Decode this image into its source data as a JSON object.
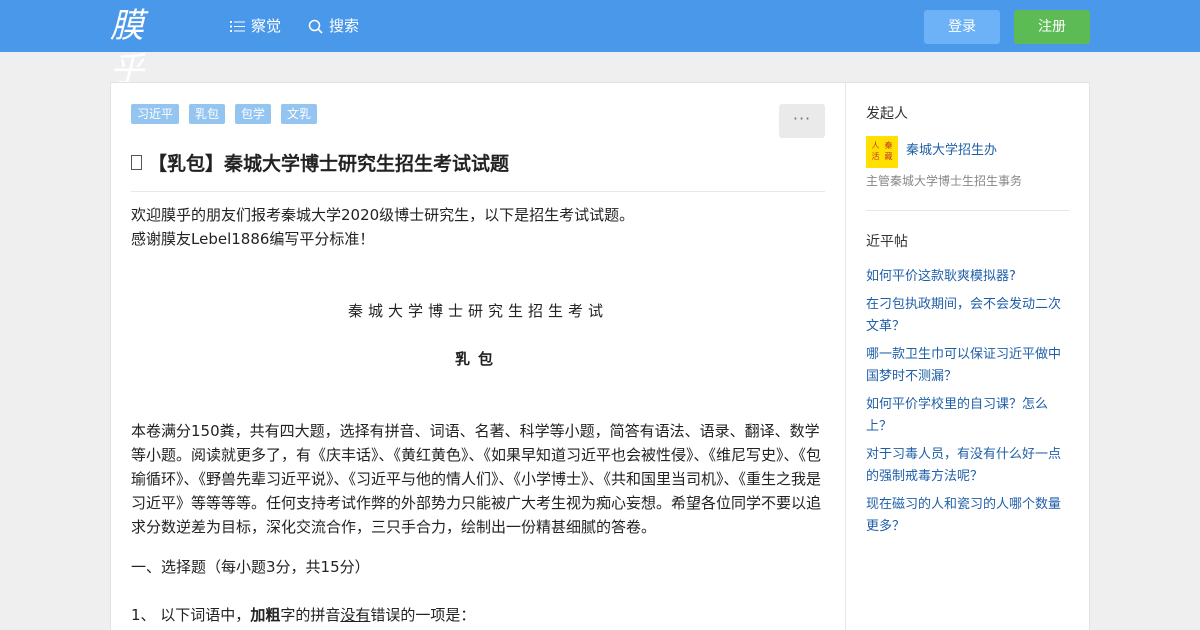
{
  "header": {
    "logo": "膜乎",
    "nav": [
      {
        "label": "察觉",
        "icon": "list-icon"
      },
      {
        "label": "搜索",
        "icon": "search-icon"
      }
    ],
    "login_label": "登录",
    "signup_label": "注册"
  },
  "colors": {
    "header_bg": "#4a98ea",
    "tag_bg": "#94c4f0",
    "login_bg": "#6db2f7",
    "signup_bg": "#5cbb55",
    "link": "#1f5fa8"
  },
  "question": {
    "tags": [
      "习近平",
      "乳包",
      "包学",
      "文乳"
    ],
    "more_label": "···",
    "title": "【乳包】秦城大学博士研究生招生考试试题",
    "intro_1": "欢迎膜乎的朋友们报考秦城大学2020级博士研究生，以下是招生考试试题。",
    "intro_2": "感谢膜友Lebel1886编写平分标准！",
    "exam_title": "秦城大学博士研究生招生考试",
    "subject": "乳包",
    "description": "本卷满分150粪，共有四大题，选择有拼音、词语、名著、科学等小题，简答有语法、语录、翻译、数学等小题。阅读就更多了，有《庆丰话》、《黄红黄色》、《如果早知道习近平也会被性侵》、《维尼写史》、《包瑜循环》、《野兽先辈习近平说》、《习近平与他的情人们》、《小学博士》、《共和国里当司机》、《重生之我是习近平》等等等等。任何支持考试作弊的外部势力只能被广大考生视为痴心妄想。希望各位同学不要以追求分数逆差为目标，深化交流合作，三只手合力，绘制出一份精甚细腻的答卷。",
    "section_1": "一、选择题（每小题3分，共15分）",
    "q1_prefix": "1、 以下词语中，",
    "q1_bold": "加粗",
    "q1_mid": "字的拼音",
    "q1_underline": "没有",
    "q1_suffix": "错误的一项是："
  },
  "sidebar": {
    "initiator_label": "发起人",
    "author_name": "秦城大学招生办",
    "author_desc": "主管秦城大学博士生招生事务",
    "avatar_text": [
      "人",
      "秦",
      "活",
      "藏"
    ],
    "related_label": "近平帖",
    "related": [
      "如何平价这款耿爽模拟器?",
      "在刁包执政期间，会不会发动二次文革？",
      "哪一款卫生巾可以保证习近平做中国梦时不测漏？",
      "如何平价学校里的自习课？怎么上？",
      "对于习毒人员，有没有什么好一点的强制戒毒方法呢？",
      "现在磁习的人和瓷习的人哪个数量更多？"
    ]
  }
}
